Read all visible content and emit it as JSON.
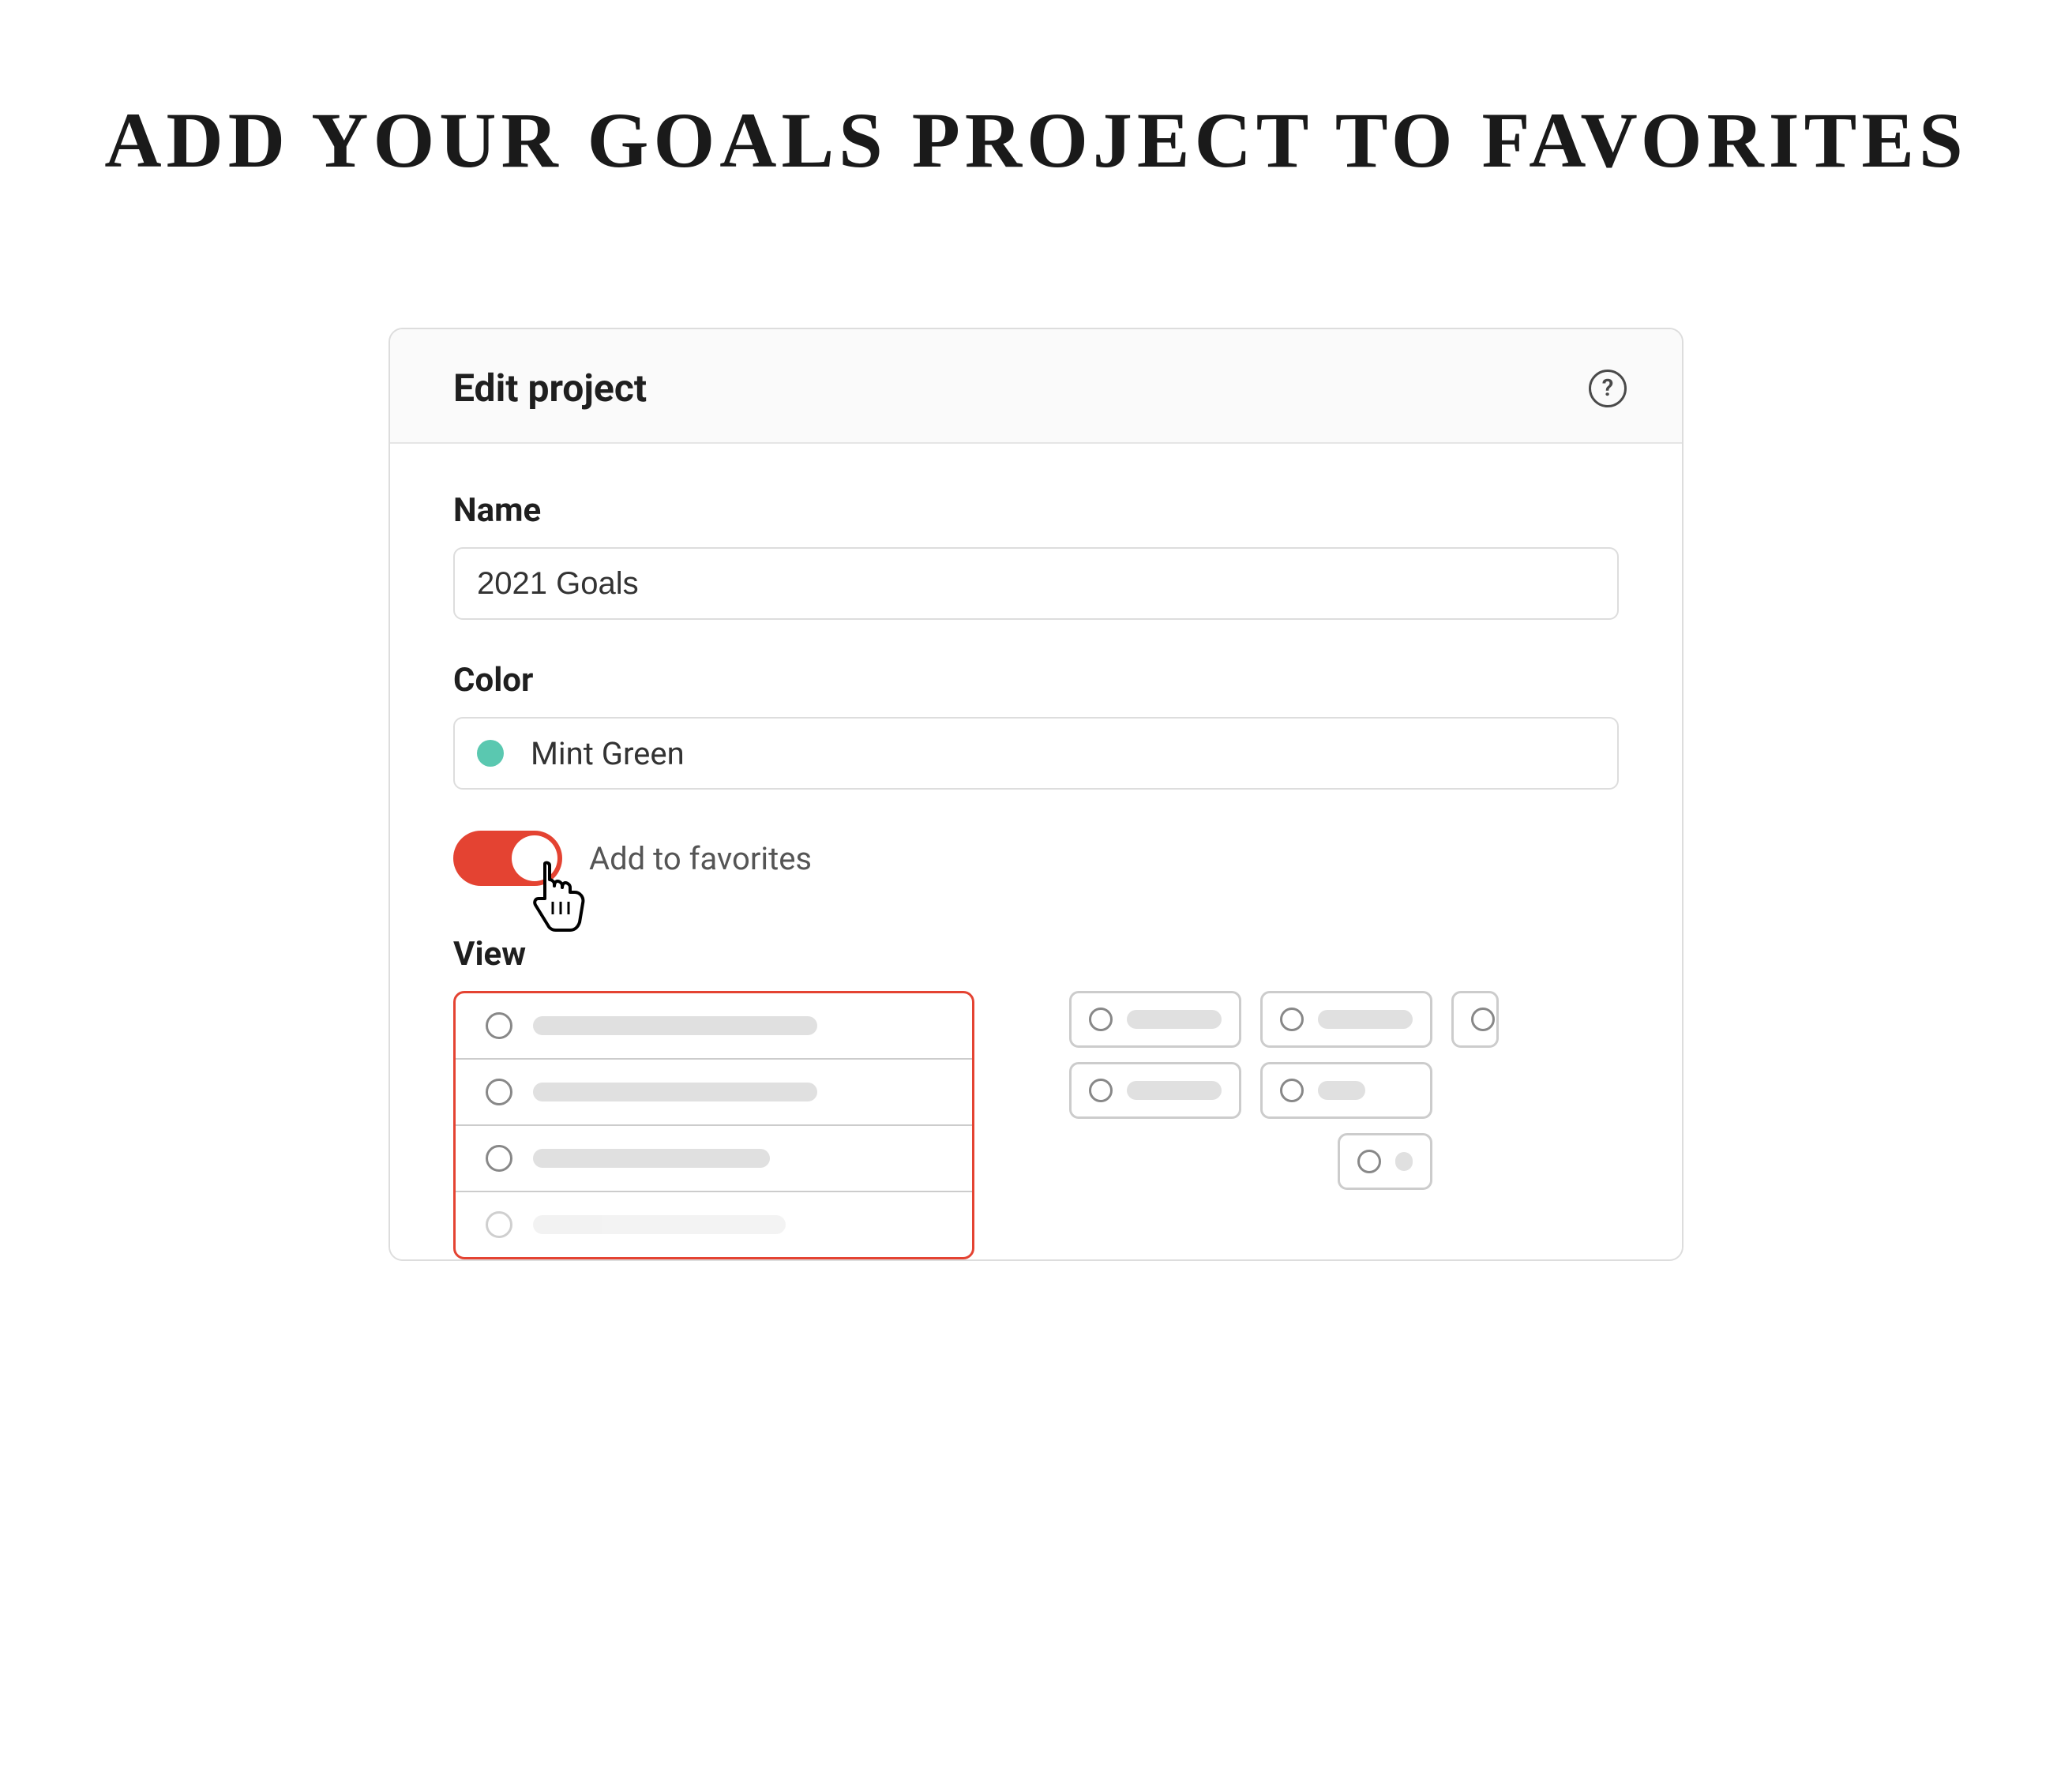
{
  "page": {
    "heading": "ADD YOUR GOALS PROJECT TO FAVORITES"
  },
  "dialog": {
    "title": "Edit project",
    "help_symbol": "?",
    "name_label": "Name",
    "name_value": "2021 Goals",
    "color_label": "Color",
    "color_name": "Mint Green",
    "color_hex": "#5ac8b0",
    "favorites_label": "Add to favorites",
    "favorites_on": true,
    "view_label": "View",
    "view_selected": "list",
    "view_options": [
      "list",
      "board"
    ],
    "accent_color": "#e44332"
  }
}
